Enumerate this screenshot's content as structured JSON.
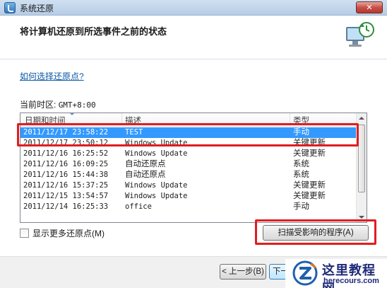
{
  "window": {
    "title": "系统还原",
    "close_label": "✕"
  },
  "header": {
    "title": "将计算机还原到所选事件之前的状态"
  },
  "body": {
    "help_link": "如何选择还原点?",
    "timezone_label": "当前时区:",
    "timezone_value": "GMT+8:00"
  },
  "table": {
    "columns": [
      "日期和时间",
      "描述",
      "类型"
    ],
    "rows": [
      {
        "datetime": "2011/12/17 23:58:22",
        "description": "TEST",
        "type": "手动",
        "selected": true
      },
      {
        "datetime": "2011/12/17 23:50:12",
        "description": "Windows Update",
        "type": "关键更新",
        "selected": false
      },
      {
        "datetime": "2011/12/16 16:25:52",
        "description": "Windows Update",
        "type": "关键更新",
        "selected": false
      },
      {
        "datetime": "2011/12/16 16:09:25",
        "description": "自动还原点",
        "type": "系统",
        "selected": false
      },
      {
        "datetime": "2011/12/16 15:44:38",
        "description": "自动还原点",
        "type": "系统",
        "selected": false
      },
      {
        "datetime": "2011/12/16 15:37:25",
        "description": "Windows Update",
        "type": "关键更新",
        "selected": false
      },
      {
        "datetime": "2011/12/15 13:54:57",
        "description": "Windows Update",
        "type": "关键更新",
        "selected": false
      },
      {
        "datetime": "2011/12/14 16:25:33",
        "description": "office",
        "type": "手动",
        "selected": false
      }
    ]
  },
  "controls": {
    "show_more_label": "显示更多还原点(M)",
    "show_more_checked": false,
    "scan_button": "扫描受影响的程序(A)"
  },
  "footer": {
    "back_button": "< 上一步(B)",
    "next_button": "下一"
  },
  "watermark": {
    "title": "这里教程网",
    "url": "herecours.com"
  },
  "colors": {
    "selection": "#3399ff",
    "highlight_box": "#e01d20",
    "link": "#0b5aa8"
  },
  "icons": {
    "app": "system-restore-icon",
    "header": "computer-restore-icon",
    "watermark": "z-logo-icon"
  }
}
